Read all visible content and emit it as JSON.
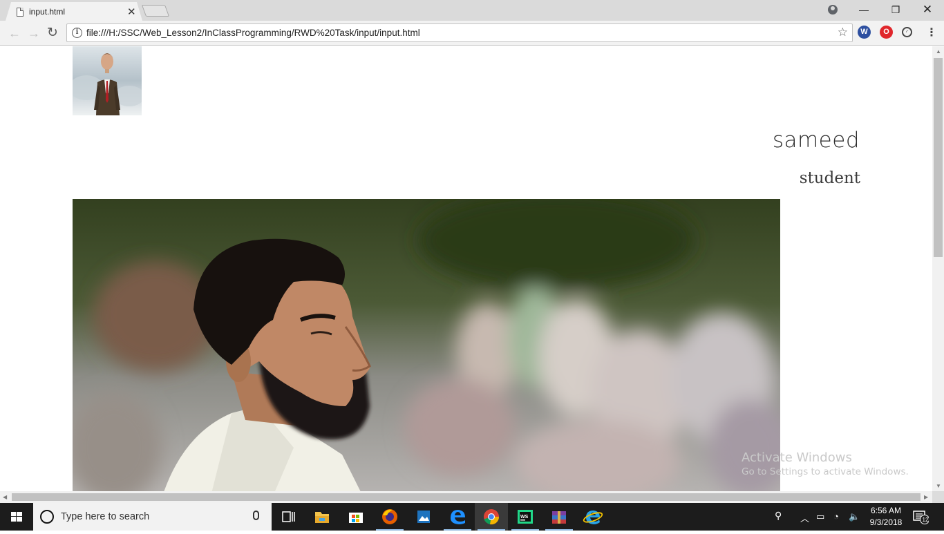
{
  "browser": {
    "tab_title": "input.html",
    "url": "file:///H:/SSC/Web_Lesson2/InClassProgramming/RWD%20Task/input/input.html",
    "icons": [
      "back-icon",
      "forward-icon",
      "reload-icon",
      "info-icon",
      "star-icon",
      "extension-w-icon",
      "opera-icon",
      "speed-icon",
      "menu-icon"
    ]
  },
  "page": {
    "name": "sameed",
    "role": "student"
  },
  "watermark": {
    "title": "Activate Windows",
    "subtitle": "Go to Settings to activate Windows."
  },
  "taskbar": {
    "search_placeholder": "Type here to search",
    "time": "6:56 AM",
    "date": "9/3/2018",
    "notification_count": "12",
    "apps": [
      "task-view",
      "file-explorer",
      "store",
      "firefox",
      "photos",
      "edge",
      "chrome",
      "webstorm",
      "winrar",
      "internet-explorer"
    ]
  },
  "colors": {
    "titlebar": "#dadada",
    "toolbar": "#f2f2f2",
    "taskbar": "#1c1c1c"
  }
}
